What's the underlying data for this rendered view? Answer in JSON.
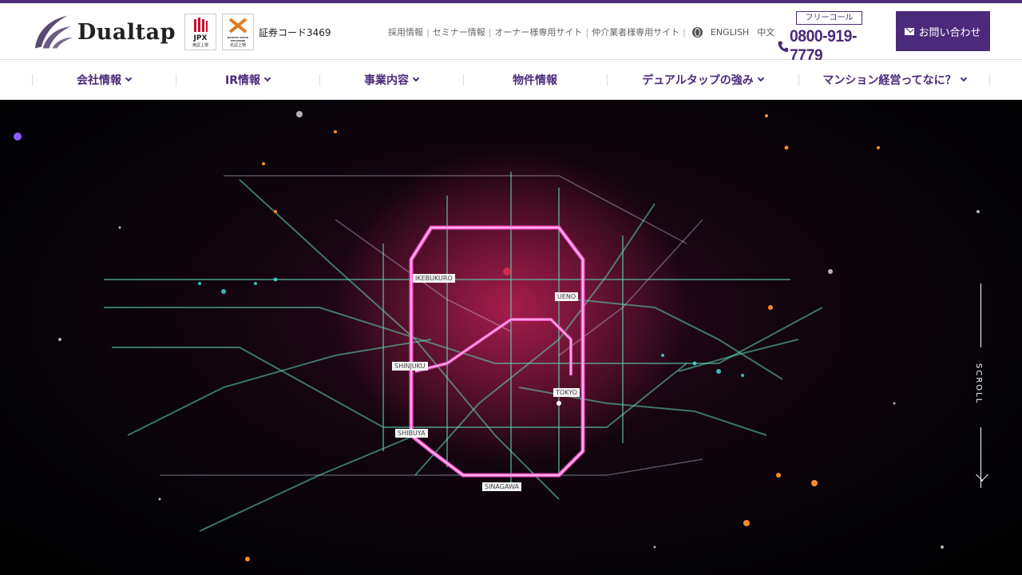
{
  "brand": {
    "name": "Dualtap",
    "accent": "#4b2a7b"
  },
  "badges": {
    "jpx": {
      "label": "JPX",
      "caption": "東証上場"
    },
    "nagoya": {
      "label": "NAGOYA STOCK EXCHANGE",
      "caption": "名証上場"
    }
  },
  "stock_code": "証券コード3469",
  "util_links": [
    "採用情報",
    "セミナー情報",
    "オーナー様専用サイト",
    "仲介業者様専用サイト"
  ],
  "languages": [
    "ENGLISH",
    "中文"
  ],
  "freecall": {
    "tag": "フリーコール",
    "number": "0800-919-7779"
  },
  "contact_button": "お問い合わせ",
  "nav": [
    {
      "label": "会社情報",
      "dropdown": true
    },
    {
      "label": "IR情報",
      "dropdown": true
    },
    {
      "label": "事業内容",
      "dropdown": true
    },
    {
      "label": "物件情報",
      "dropdown": false
    },
    {
      "label": "デュアルタップの強み",
      "dropdown": true
    },
    {
      "label": "マンション経営ってなに？",
      "dropdown": true
    }
  ],
  "hero": {
    "stations": [
      "IKEBUKURO",
      "UENO",
      "SHINJUKU",
      "TOKYO",
      "SHIBUYA",
      "SINAGAWA"
    ]
  },
  "scroll_label": "SCROLL"
}
